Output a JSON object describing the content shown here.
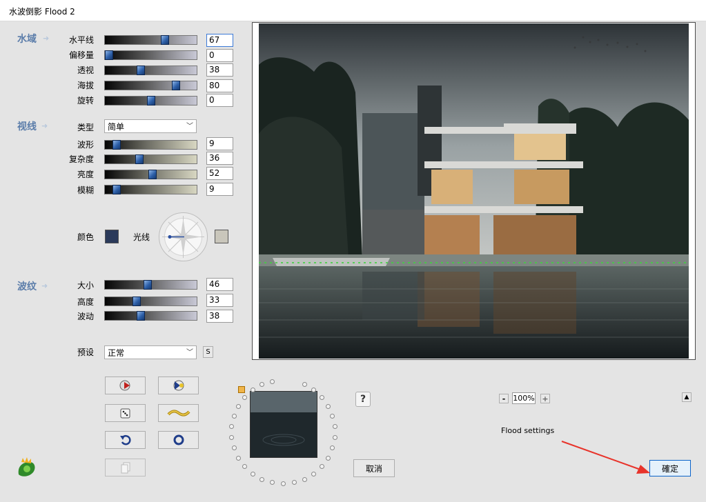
{
  "window": {
    "title": "水波倒影 Flood 2"
  },
  "sections": {
    "water": "水域",
    "sight": "视线",
    "ripple": "波纹"
  },
  "water": {
    "horizon_label": "水平线",
    "horizon_value": "67",
    "offset_label": "偏移量",
    "offset_value": "0",
    "perspective_label": "透视",
    "perspective_value": "38",
    "altitude_label": "海拔",
    "altitude_value": "80",
    "rotation_label": "旋转",
    "rotation_value": "0"
  },
  "sight": {
    "type_label": "类型",
    "type_value": "简单",
    "waveform_label": "波形",
    "waveform_value": "9",
    "complexity_label": "复杂度",
    "complexity_value": "36",
    "brightness_label": "亮度",
    "brightness_value": "52",
    "blur_label": "模糊",
    "blur_value": "9",
    "color_label": "颜色",
    "light_label": "光线"
  },
  "ripple": {
    "size_label": "大小",
    "size_value": "46",
    "height_label": "高度",
    "height_value": "33",
    "wave_label": "波动",
    "wave_value": "38"
  },
  "preset": {
    "label": "预设",
    "value": "正常",
    "save_icon": "S"
  },
  "zoom": {
    "minus": "-",
    "value": "100%",
    "plus": "+"
  },
  "help": {
    "label": "?"
  },
  "scroll_up": {
    "label": "▲"
  },
  "status_text": "Flood settings",
  "buttons": {
    "cancel": "取消",
    "ok": "確定"
  },
  "colors": {
    "section_title": "#5b7daa",
    "color_swatch": "#2b3a5a",
    "light_swatch": "#c9c6bb",
    "slider_thumb": "#2d5fa8",
    "arrow": "#e8332a"
  },
  "slider_levels": {
    "horizon": 0.67,
    "offset": 0.0,
    "perspective": 0.38,
    "altitude": 0.8,
    "rotation": 0.5,
    "waveform": 0.09,
    "complexity": 0.36,
    "brightness": 0.52,
    "blur": 0.09,
    "size": 0.46,
    "height": 0.33,
    "wave": 0.38
  }
}
